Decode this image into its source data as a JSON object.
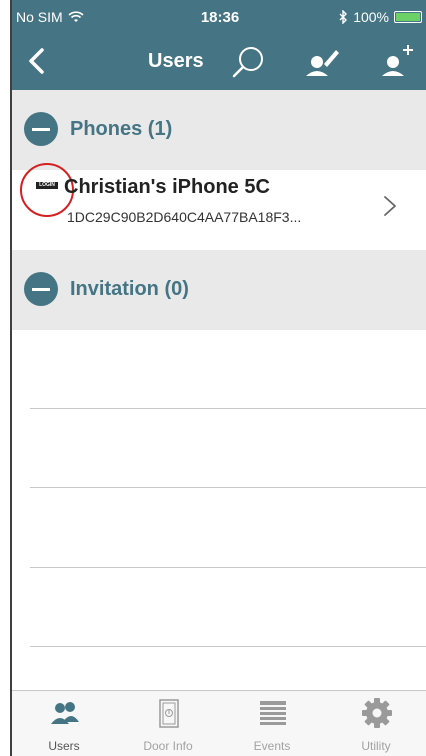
{
  "status_bar": {
    "carrier": "No SIM",
    "time": "18:36",
    "battery": "100%"
  },
  "nav": {
    "title": "Users"
  },
  "sections": {
    "phones": {
      "label": "Phones (1)"
    },
    "invitation": {
      "label": "Invitation (0)"
    }
  },
  "phone_item": {
    "badge": "LOGIN",
    "name": "Christian's iPhone 5C",
    "uid": "1DC29C90B2D640C4AA77BA18F3..."
  },
  "tabs": [
    {
      "label": "Users",
      "icon": "users-icon",
      "active": true
    },
    {
      "label": "Door Info",
      "icon": "door-icon",
      "active": false
    },
    {
      "label": "Events",
      "icon": "events-list-icon",
      "active": false
    },
    {
      "label": "Utility",
      "icon": "gear-icon",
      "active": false
    }
  ],
  "colors": {
    "primary": "#457584",
    "section_bg": "#e9e9e9",
    "annotation_circle": "#d42020"
  }
}
